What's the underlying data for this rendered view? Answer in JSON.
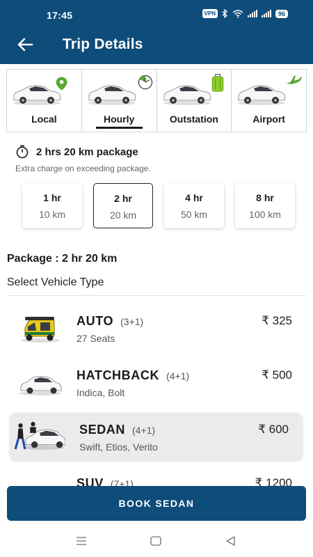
{
  "status_bar": {
    "time": "17:45",
    "vpn": "VPN",
    "battery": "96"
  },
  "app_bar": {
    "title": "Trip Details"
  },
  "trip_tabs": [
    {
      "label": "Local",
      "icon": "location-pin-icon",
      "selected": false
    },
    {
      "label": "Hourly",
      "icon": "clock-icon",
      "selected": true
    },
    {
      "label": "Outstation",
      "icon": "luggage-icon",
      "selected": false
    },
    {
      "label": "Airport",
      "icon": "airplane-icon",
      "selected": false
    }
  ],
  "package_info": {
    "headline": "2 hrs 20 km package",
    "note": "Extra charge on exceeding package.",
    "options": [
      {
        "hours": "1 hr",
        "km": "10 km",
        "selected": false
      },
      {
        "hours": "2 hr",
        "km": "20 km",
        "selected": true
      },
      {
        "hours": "4 hr",
        "km": "50 km",
        "selected": false
      },
      {
        "hours": "8 hr",
        "km": "100 km",
        "selected": false
      }
    ],
    "package_line": "Package : 2 hr 20 km",
    "select_vehicle_label": "Select Vehicle Type"
  },
  "vehicles": [
    {
      "name": "AUTO",
      "capacity": "(3+1)",
      "models": "27 Seats",
      "price": "₹ 325",
      "selected": false
    },
    {
      "name": "HATCHBACK",
      "capacity": "(4+1)",
      "models": "Indica, Bolt",
      "price": "₹ 500",
      "selected": false
    },
    {
      "name": "SEDAN",
      "capacity": "(4+1)",
      "models": "Swift, Etios, Verito",
      "price": "₹ 600",
      "selected": true
    },
    {
      "name": "SUV",
      "capacity": "(7+1)",
      "models": "",
      "price": "₹ 1200",
      "selected": false
    }
  ],
  "book_button": {
    "label": "BOOK SEDAN"
  },
  "colors": {
    "primary": "#0e4c7a",
    "selected_row": "#ebebeb",
    "pin_green": "#5aa833",
    "luggage_green": "#8ccf2a"
  }
}
